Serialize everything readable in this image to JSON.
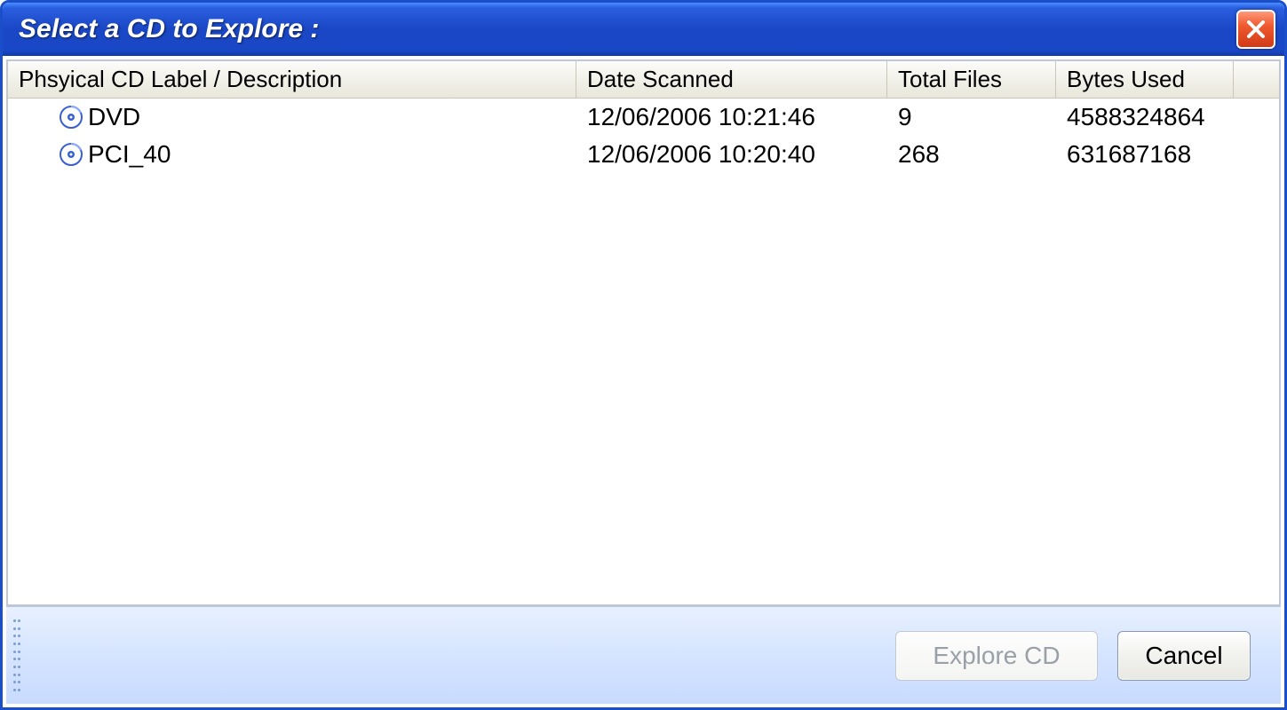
{
  "window": {
    "title": "Select a CD to Explore :"
  },
  "columns": {
    "label": "Phsyical CD Label / Description",
    "date": "Date Scanned",
    "files": "Total Files",
    "bytes": "Bytes Used"
  },
  "rows": [
    {
      "label": "DVD",
      "date": "12/06/2006 10:21:46",
      "files": "9",
      "bytes": "4588324864"
    },
    {
      "label": "PCI_40",
      "date": "12/06/2006 10:20:40",
      "files": "268",
      "bytes": "631687168"
    }
  ],
  "buttons": {
    "explore": "Explore CD",
    "cancel": "Cancel"
  }
}
